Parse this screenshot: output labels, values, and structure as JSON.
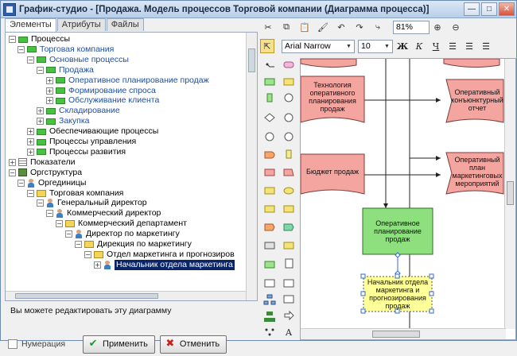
{
  "window": {
    "title": "График-студио - [Продажа. Модель процессов Торговой компании (Диаграмма процесса)]",
    "min_label": "—",
    "max_label": "□",
    "close_label": "✕"
  },
  "tabs": [
    {
      "label": "Элементы",
      "active": true
    },
    {
      "label": "Атрибуты",
      "active": false
    },
    {
      "label": "Файлы",
      "active": false
    }
  ],
  "tree": [
    {
      "label": "Процессы",
      "exp": "−",
      "icon": "green",
      "blue": false
    },
    {
      "label": "Торговая компания",
      "exp": "−",
      "icon": "green",
      "blue": true
    },
    {
      "label": "Основные процессы",
      "exp": "−",
      "icon": "green",
      "blue": true
    },
    {
      "label": "Продажа",
      "exp": "−",
      "icon": "green",
      "blue": true
    },
    {
      "label": "Оперативное планирование продаж",
      "exp": "+",
      "icon": "green",
      "blue": true
    },
    {
      "label": "Формирование спроса",
      "exp": "+",
      "icon": "green",
      "blue": true
    },
    {
      "label": "Обслуживание клиента",
      "exp": "+",
      "icon": "green",
      "blue": true
    },
    {
      "label": "Складирование",
      "exp": "+",
      "icon": "green",
      "blue": true
    },
    {
      "label": "Закупка",
      "exp": "+",
      "icon": "green",
      "blue": true
    },
    {
      "label": "Обеспечивающие процессы",
      "exp": "+",
      "icon": "green",
      "blue": false
    },
    {
      "label": "Процессы управления",
      "exp": "+",
      "icon": "green",
      "blue": false
    },
    {
      "label": "Процессы развития",
      "exp": "+",
      "icon": "green",
      "blue": false
    },
    {
      "label": "Показатели",
      "exp": "+",
      "icon": "list",
      "blue": false
    },
    {
      "label": "Оргструктура",
      "exp": "−",
      "icon": "org",
      "blue": false
    },
    {
      "label": "Оргединицы",
      "exp": "−",
      "icon": "person",
      "blue": false
    },
    {
      "label": "Торговая компания",
      "exp": "−",
      "icon": "folder",
      "blue": false
    },
    {
      "label": "Генеральный директор",
      "exp": "−",
      "icon": "person",
      "blue": false
    },
    {
      "label": "Коммерческий директор",
      "exp": "−",
      "icon": "person",
      "blue": false
    },
    {
      "label": "Коммерческий департамент",
      "exp": "−",
      "icon": "folder",
      "blue": false
    },
    {
      "label": "Директор по маркетингу",
      "exp": "−",
      "icon": "person",
      "blue": false
    },
    {
      "label": "Дирекция по маркетингу",
      "exp": "−",
      "icon": "folder",
      "blue": false
    },
    {
      "label": "Отдел маркетинга и прогнозиров",
      "exp": "−",
      "icon": "folder",
      "blue": false
    },
    {
      "label": "Начальник отдела маркетинга",
      "exp": "+",
      "icon": "person",
      "blue": false,
      "selected": true
    }
  ],
  "info_text": "Вы можете редактировать эту диаграмму",
  "checkbox_label": "Нумерация",
  "apply_label": "Применить",
  "cancel_label": "Отменить",
  "zoom_value": "81%",
  "font_name": "Arial Narrow",
  "font_size": "10",
  "format_buttons": [
    "Ж",
    "К",
    "Ч"
  ],
  "canvas": {
    "box1": "Технология оперативного планирования продаж",
    "box2": "Оперативный конъюнктурный отчет",
    "box3": "Бюджет продаж",
    "box4": "Оперативный план маркетинговых мероприятий",
    "process": "Оперативное планирование продаж",
    "role": "Начальник отдела маркетинга и прогнозирования продаж"
  },
  "colors": {
    "doc_fill": "#f4a5a0",
    "process_fill": "#8ee07f",
    "role_fill": "#ffff99",
    "selection": "#0a246a"
  }
}
